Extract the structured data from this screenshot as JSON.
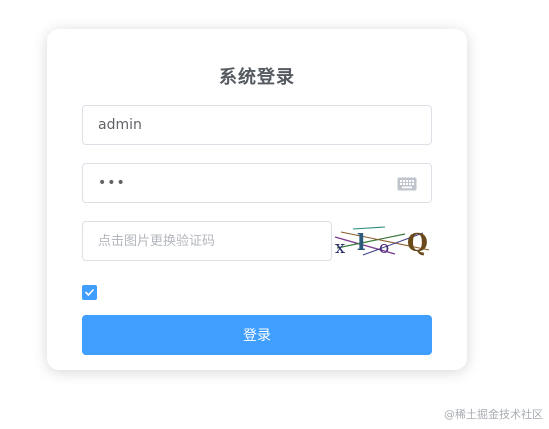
{
  "login": {
    "title": "系统登录",
    "username_value": "admin",
    "password_value": "123",
    "captcha_placeholder": "点击图片更换验证码",
    "captcha_text": [
      "x",
      "l",
      "o",
      "Q"
    ],
    "remember_checked": true,
    "submit_label": "登录"
  },
  "icons": {
    "keyboard": "keyboard-icon",
    "check": "check-icon"
  },
  "colors": {
    "primary": "#409eff",
    "title": "#555a61",
    "border": "#dcdfe6",
    "placeholder": "#b4b7be"
  },
  "watermark": "@稀土掘金技术社区"
}
